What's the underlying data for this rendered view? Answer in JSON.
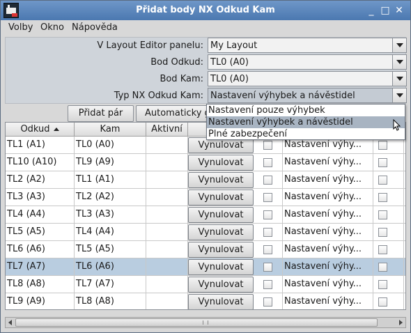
{
  "window": {
    "title": "Přidat body NX Odkud Kam",
    "controls": [
      "_",
      "□",
      "✕"
    ]
  },
  "menu": [
    "Volby",
    "Okno",
    "Nápověda"
  ],
  "form": {
    "layout_label": "V Layout Editor panelu:",
    "layout_value": "My Layout",
    "from_label": "Bod Odkud:",
    "from_value": "TL0 (A0)",
    "to_label": "Bod Kam:",
    "to_value": "TL0 (A0)",
    "type_label": "Typ NX Odkud Kam:",
    "type_value": "Nastavení výhybek a návěstidel"
  },
  "buttons": {
    "add_pair": "Přidat pár",
    "auto": "Automaticky g"
  },
  "dropdown": {
    "options": [
      "Nastavení pouze výhybek",
      "Nastavení výhybek a návěstidel",
      "Plné zabezpečení"
    ],
    "highlighted_index": 1
  },
  "table": {
    "headers": [
      "Odkud",
      "Kam",
      "Aktivní"
    ],
    "button_label": "Vynulovat",
    "selected_row": 7,
    "rows": [
      {
        "from": "TL1 (A1)",
        "to": "TL0 (A0)",
        "type": "Nastavení výhy..."
      },
      {
        "from": "TL10 (A10)",
        "to": "TL9 (A9)",
        "type": "Nastavení výhy..."
      },
      {
        "from": "TL2 (A2)",
        "to": "TL1 (A1)",
        "type": "Nastavení výhy..."
      },
      {
        "from": "TL3 (A3)",
        "to": "TL2 (A2)",
        "type": "Nastavení výhy..."
      },
      {
        "from": "TL4 (A4)",
        "to": "TL3 (A3)",
        "type": "Nastavení výhy..."
      },
      {
        "from": "TL5 (A5)",
        "to": "TL4 (A4)",
        "type": "Nastavení výhy..."
      },
      {
        "from": "TL6 (A6)",
        "to": "TL5 (A5)",
        "type": "Nastavení výhy..."
      },
      {
        "from": "TL7 (A7)",
        "to": "TL6 (A6)",
        "type": "Nastavení výhy..."
      },
      {
        "from": "TL8 (A8)",
        "to": "TL7 (A7)",
        "type": "Nastavení výhy..."
      },
      {
        "from": "TL9 (A9)",
        "to": "TL8 (A8)",
        "type": "Nastavení výhy..."
      }
    ]
  },
  "colors": {
    "titlebar": "#5a86bd",
    "selected_row": "#b9cde0",
    "highlight": "#a8b4c2"
  }
}
